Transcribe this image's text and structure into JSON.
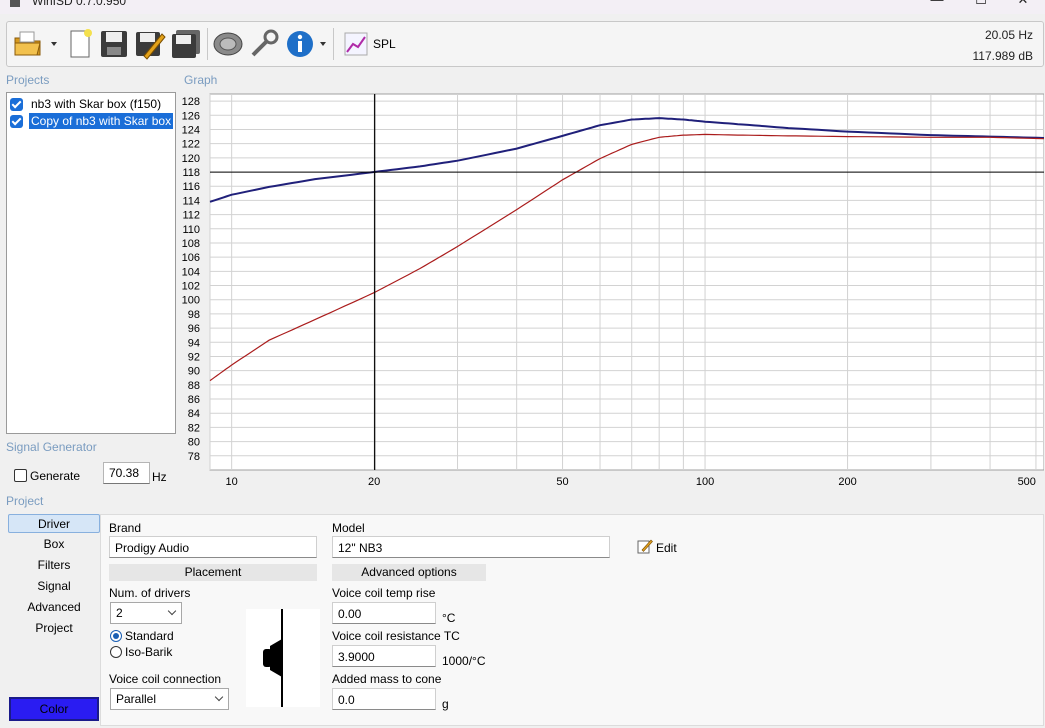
{
  "window": {
    "title": "WinISD 0.7.0.950",
    "minimize": "—",
    "maximize": "☐",
    "close": "✕"
  },
  "toolbar": {
    "buttons": [
      "open-icon",
      "new-icon",
      "save-icon",
      "edit-save-icon",
      "save-all-icon",
      "driver-icon",
      "tools-icon",
      "info-icon",
      "spl-graph-icon"
    ],
    "spl_label": "SPL",
    "readout_freq": "20.05 Hz",
    "readout_level": "117.989 dB"
  },
  "sections": {
    "projects": "Projects",
    "graph": "Graph",
    "signal_generator": "Signal Generator",
    "project": "Project"
  },
  "projects": [
    {
      "label": "nb3 with Skar box (f150)",
      "checked": true,
      "selected": false
    },
    {
      "label": "Copy of nb3 with Skar box",
      "checked": true,
      "selected": true
    }
  ],
  "signal_generator": {
    "generate_label": "Generate",
    "frequency": "70.38",
    "unit": "Hz",
    "checked": false
  },
  "tabs": [
    "Driver",
    "Box",
    "Filters",
    "Signal",
    "Advanced",
    "Project"
  ],
  "active_tab": "Driver",
  "color_button": "Color",
  "driver": {
    "brand_label": "Brand",
    "brand": "Prodigy Audio",
    "model_label": "Model",
    "model": "12\" NB3",
    "edit_label": "Edit",
    "placement_header": "Placement",
    "num_drivers_label": "Num. of drivers",
    "num_drivers": "2",
    "standard_label": "Standard",
    "isobarik_label": "Iso-Barik",
    "placement_mode": "Standard",
    "vc_connection_label": "Voice coil connection",
    "vc_connection": "Parallel",
    "advanced_header": "Advanced options",
    "vc_temp_rise_label": "Voice coil temp rise",
    "vc_temp_rise": "0.00",
    "vc_temp_rise_unit": "°C",
    "vc_resistance_tc_label": "Voice coil resistance TC",
    "vc_resistance_tc": "3.9000",
    "vc_resistance_tc_unit": "1000/°C",
    "added_mass_label": "Added mass to cone",
    "added_mass": "0.0",
    "added_mass_unit": "g"
  },
  "chart_data": {
    "type": "line",
    "x_scale": "log",
    "xlim": [
      9,
      520
    ],
    "ylim": [
      76,
      129
    ],
    "x_ticks": [
      10,
      20,
      50,
      100,
      200,
      500
    ],
    "y_ticks": [
      78,
      80,
      82,
      84,
      86,
      88,
      90,
      92,
      94,
      96,
      98,
      100,
      102,
      104,
      106,
      108,
      110,
      112,
      114,
      116,
      118,
      120,
      122,
      124,
      126,
      128
    ],
    "grid": true,
    "cursor": {
      "x": 20.05,
      "y": 117.989
    },
    "colors": {
      "series_blue": "#20207a",
      "series_red": "#aa1c1c",
      "cursor": "#000000",
      "grid": "#d2d2d2"
    },
    "series": [
      {
        "x": [
          9,
          10,
          12,
          15,
          20,
          25,
          30,
          40,
          50,
          60,
          70,
          80,
          90,
          100,
          120,
          150,
          200,
          300,
          400,
          520
        ],
        "y": [
          113.8,
          114.8,
          115.9,
          117.0,
          118.0,
          118.8,
          119.6,
          121.3,
          123.1,
          124.6,
          125.4,
          125.6,
          125.4,
          125.1,
          124.7,
          124.2,
          123.7,
          123.2,
          123.0,
          122.8
        ]
      },
      {
        "x": [
          9,
          10,
          12,
          15,
          20,
          25,
          30,
          40,
          50,
          60,
          70,
          80,
          90,
          100,
          120,
          150,
          200,
          300,
          400,
          520
        ],
        "y": [
          88.6,
          90.8,
          94.3,
          97.2,
          101.0,
          104.4,
          107.5,
          112.7,
          116.9,
          119.9,
          121.9,
          122.9,
          123.2,
          123.3,
          123.2,
          123.1,
          123.0,
          122.9,
          122.9,
          122.7
        ]
      }
    ]
  }
}
